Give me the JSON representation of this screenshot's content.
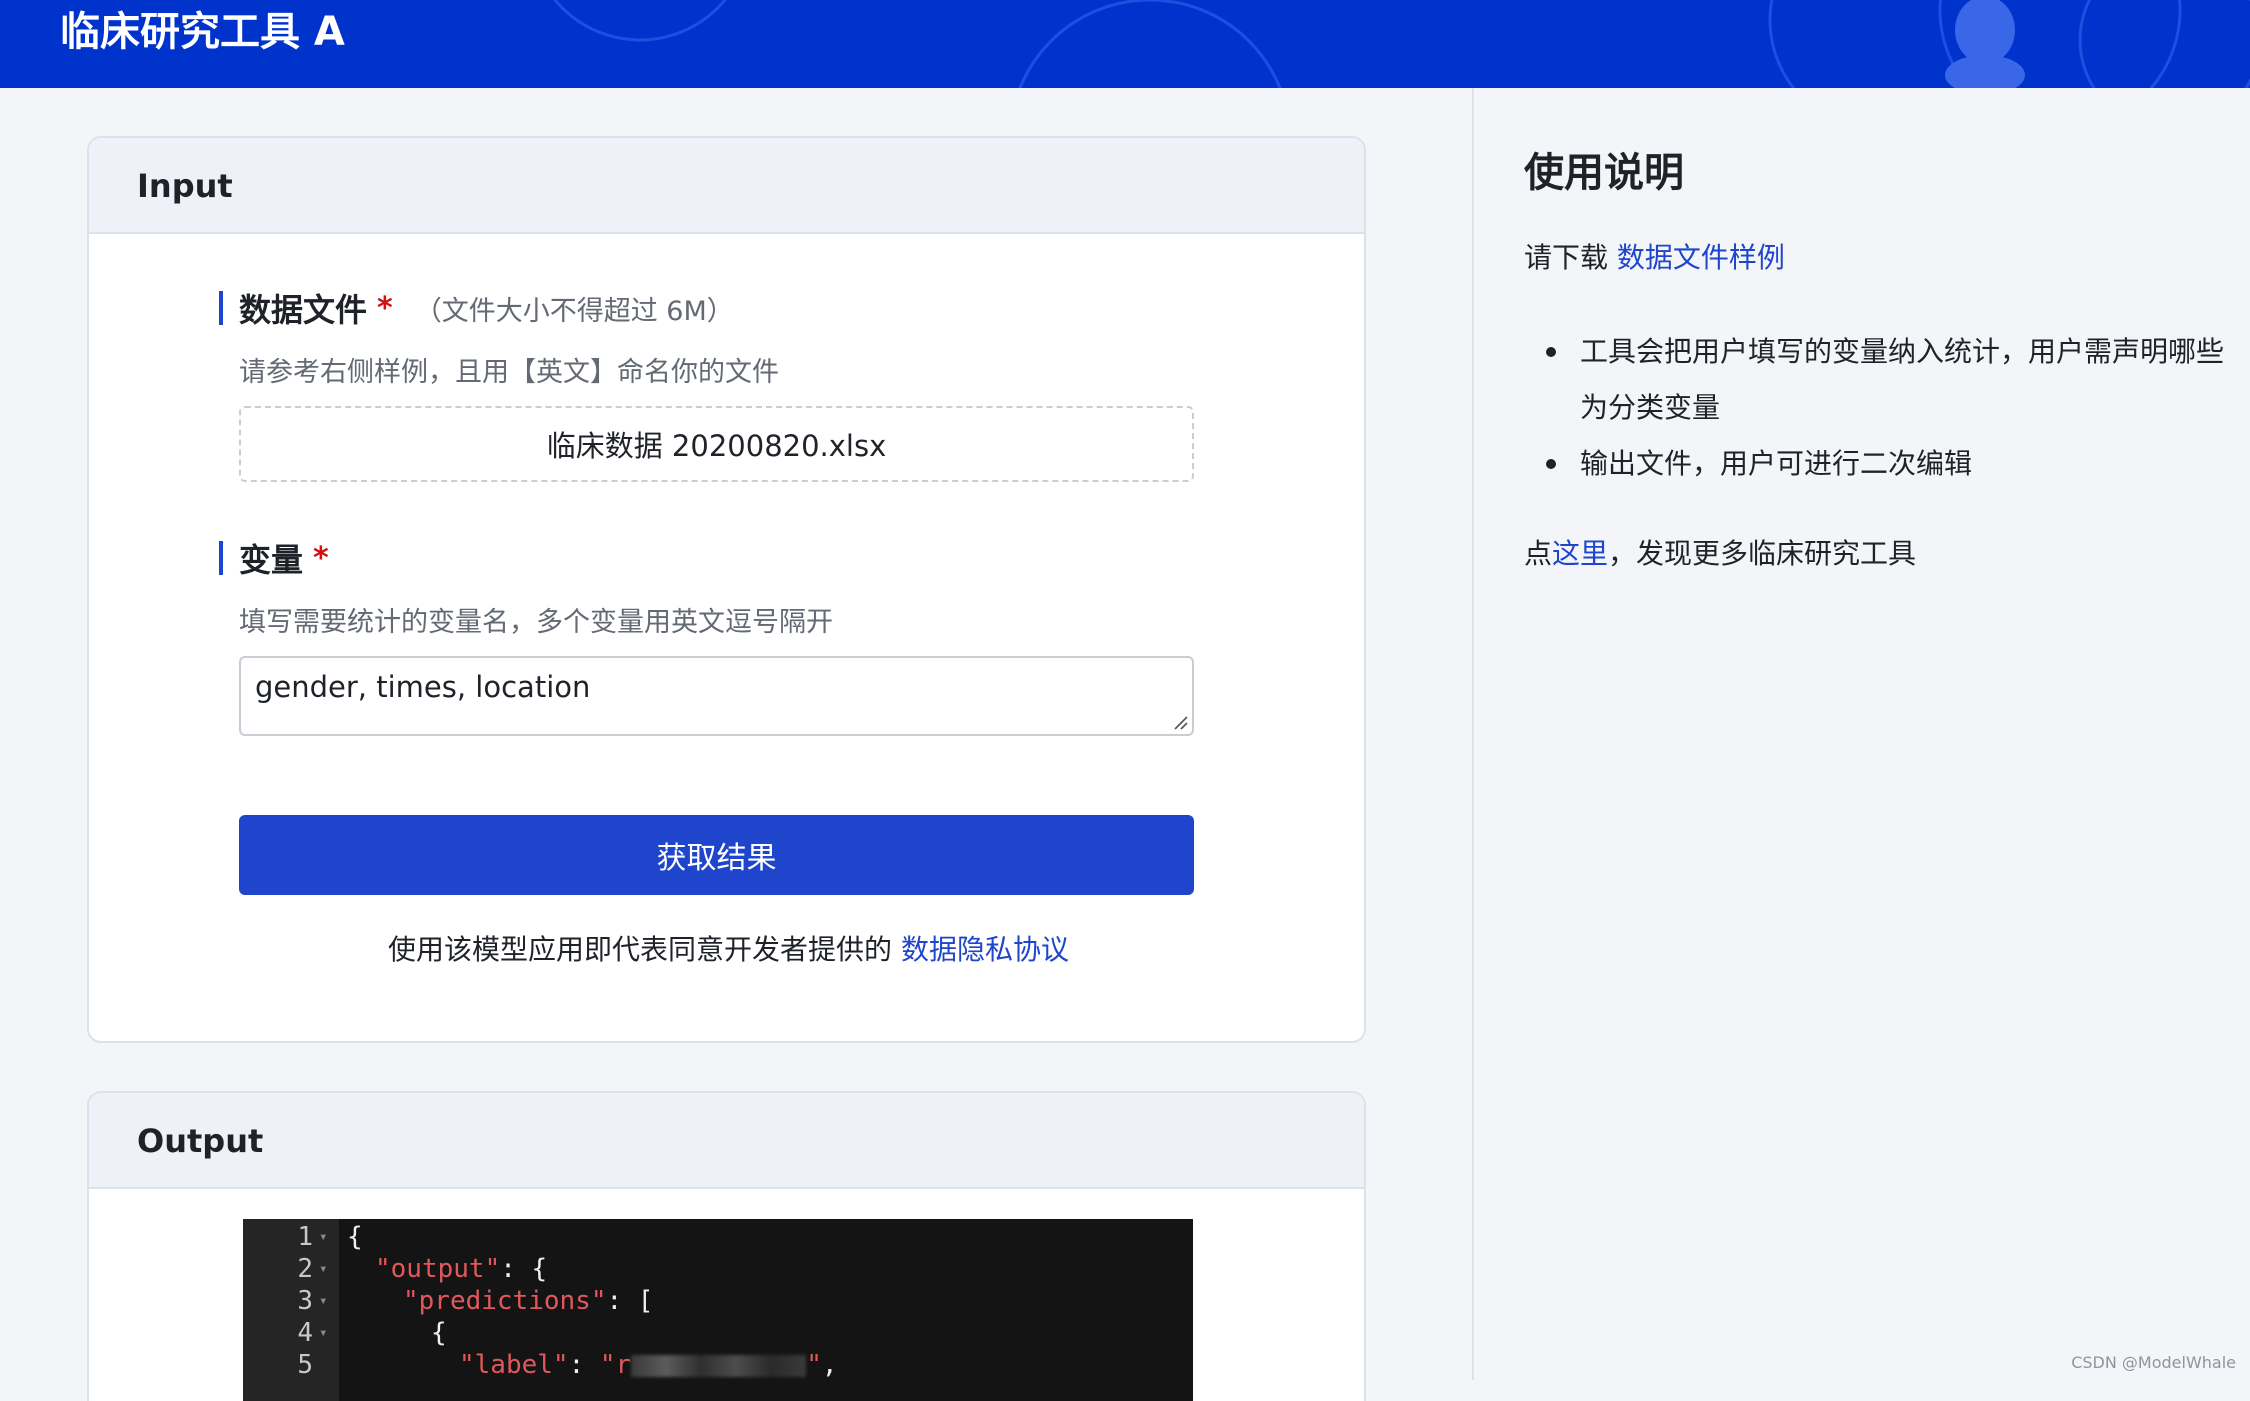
{
  "header": {
    "title": "临床研究工具 A"
  },
  "input_card": {
    "title": "Input",
    "data_file": {
      "label": "数据文件",
      "required_mark": "*",
      "note": "（文件大小不得超过 6M）",
      "hint": "请参考右侧样例，且用【英文】命名你的文件",
      "file_name": "临床数据 20200820.xlsx"
    },
    "variables": {
      "label": "变量",
      "required_mark": "*",
      "hint": "填写需要统计的变量名，多个变量用英文逗号隔开",
      "value": "gender, times, location"
    },
    "submit_label": "获取结果",
    "agreement_prefix": "使用该模型应用即代表同意开发者提供的 ",
    "agreement_link": "数据隐私协议"
  },
  "output_card": {
    "title": "Output",
    "code": {
      "line_numbers": [
        "1",
        "2",
        "3",
        "4",
        "5"
      ],
      "line1": "{",
      "line2_key": "\"output\"",
      "line2_rest": ": {",
      "line3_key": "\"predictions\"",
      "line3_rest": ": [",
      "line4": "{",
      "line5_key": "\"label\"",
      "line5_colon": ": ",
      "line5_val_start": "\"r",
      "line5_val_end": "\"",
      "line5_tail": ","
    }
  },
  "right_panel": {
    "title": "使用说明",
    "download_prefix": "请下载 ",
    "download_link": "数据文件样例",
    "bullets": [
      "工具会把用户填写的变量纳入统计，用户需声明哪些为分类变量",
      "输出文件，用户可进行二次编辑"
    ],
    "more_prefix": "点",
    "more_link": "这里",
    "more_suffix": "，发现更多临床研究工具"
  },
  "watermark": "CSDN @ModelWhale",
  "colors": {
    "header_bg": "#0033cc",
    "primary": "#1f45cc",
    "required": "#d40f0f",
    "code_string": "#e0585b"
  }
}
